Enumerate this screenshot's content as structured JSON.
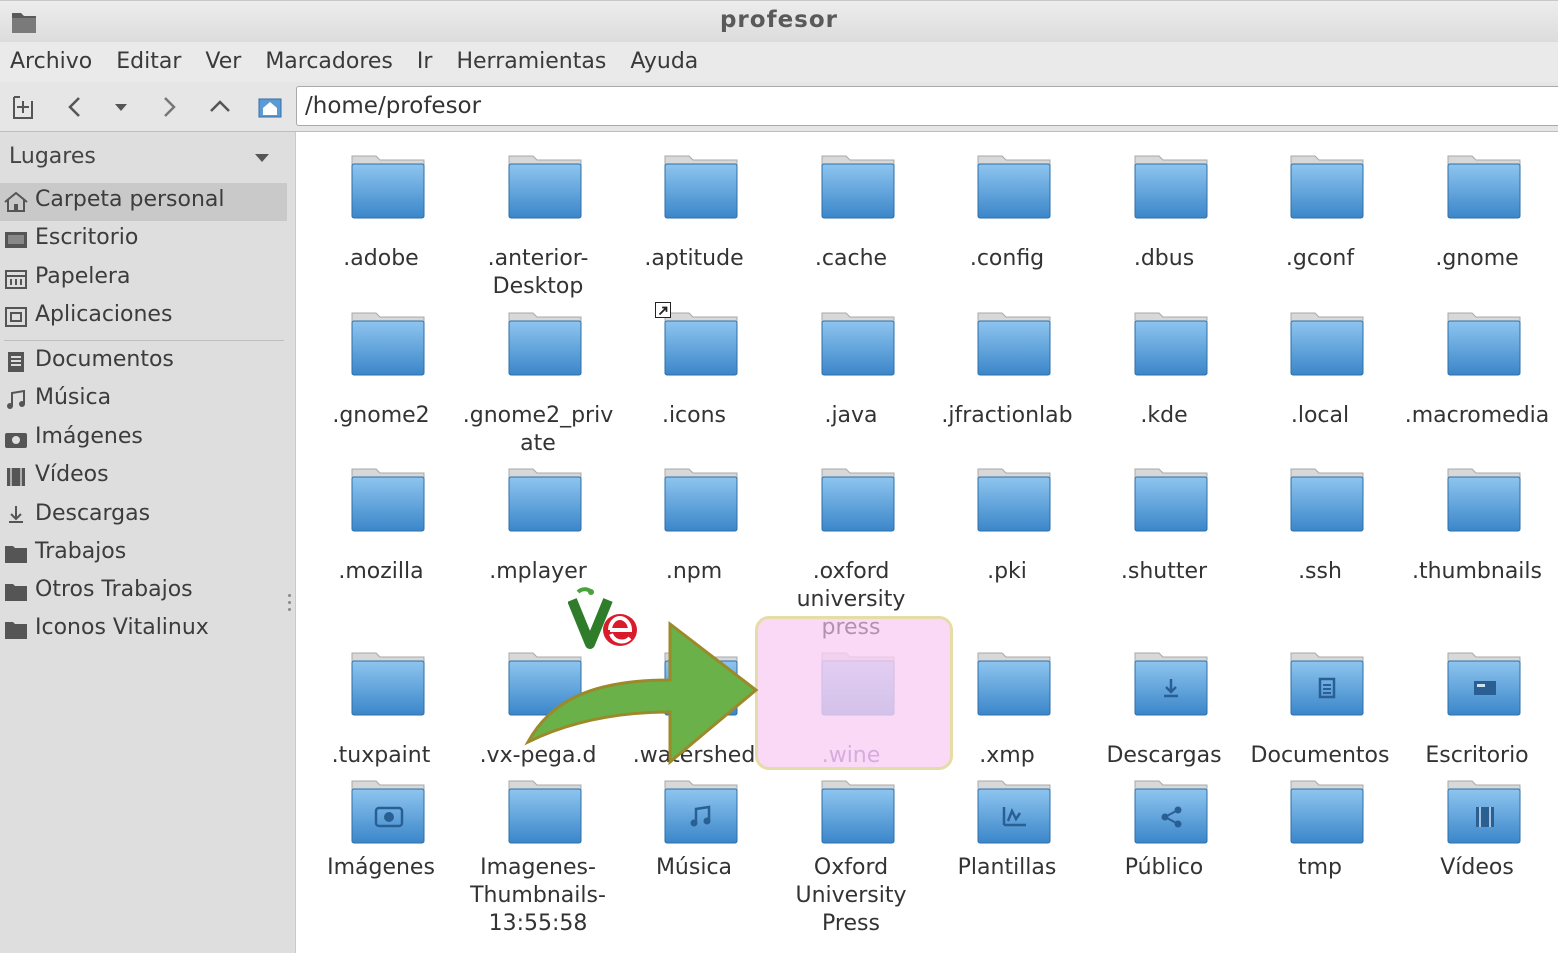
{
  "window": {
    "title": "profesor"
  },
  "menu": [
    "Archivo",
    "Editar",
    "Ver",
    "Marcadores",
    "Ir",
    "Herramientas",
    "Ayuda"
  ],
  "location": {
    "path": "/home/profesor"
  },
  "sidebar": {
    "header": "Lugares",
    "items": [
      {
        "label": "Carpeta personal",
        "icon": "home-icon",
        "active": true
      },
      {
        "label": "Escritorio",
        "icon": "desktop-icon"
      },
      {
        "label": "Papelera",
        "icon": "trash-icon"
      },
      {
        "label": "Aplicaciones",
        "icon": "applications-icon"
      },
      {
        "label": "Documentos",
        "icon": "documents-icon"
      },
      {
        "label": "Música",
        "icon": "music-icon"
      },
      {
        "label": "Imágenes",
        "icon": "camera-icon"
      },
      {
        "label": "Vídeos",
        "icon": "film-icon"
      },
      {
        "label": "Descargas",
        "icon": "download-icon"
      },
      {
        "label": "Trabajos",
        "icon": "folder-icon"
      },
      {
        "label": "Otros Trabajos",
        "icon": "folder-icon"
      },
      {
        "label": "Iconos Vitalinux",
        "icon": "folder-icon"
      }
    ]
  },
  "files": [
    {
      "name": ".adobe"
    },
    {
      "name": ".anterior-Desktop"
    },
    {
      "name": ".aptitude"
    },
    {
      "name": ".cache"
    },
    {
      "name": ".config"
    },
    {
      "name": ".dbus"
    },
    {
      "name": ".gconf"
    },
    {
      "name": ".gnome"
    },
    {
      "name": ".gnome2"
    },
    {
      "name": ".gnome2_private"
    },
    {
      "name": ".icons",
      "link": true
    },
    {
      "name": ".java"
    },
    {
      "name": ".jfractionlab"
    },
    {
      "name": ".kde"
    },
    {
      "name": ".local"
    },
    {
      "name": ".macromedia"
    },
    {
      "name": ".mozilla"
    },
    {
      "name": ".mplayer"
    },
    {
      "name": ".npm"
    },
    {
      "name": ".oxford university press"
    },
    {
      "name": ".pki"
    },
    {
      "name": ".shutter"
    },
    {
      "name": ".ssh"
    },
    {
      "name": ".thumbnails"
    },
    {
      "name": ".tuxpaint"
    },
    {
      "name": ".vx-pega.d"
    },
    {
      "name": ".watershed"
    },
    {
      "name": ".wine",
      "highlighted": true
    },
    {
      "name": ".xmp"
    },
    {
      "name": "Descargas",
      "emblem": "download-icon"
    },
    {
      "name": "Documentos",
      "emblem": "document-icon"
    },
    {
      "name": "Escritorio",
      "emblem": "desktop-icon"
    },
    {
      "name": "Imágenes",
      "emblem": "camera-icon"
    },
    {
      "name": "Imagenes-Thumbnails-13:55:58"
    },
    {
      "name": "Música",
      "emblem": "music-icon"
    },
    {
      "name": "Oxford University Press"
    },
    {
      "name": "Plantillas",
      "emblem": "template-icon"
    },
    {
      "name": "Público",
      "emblem": "share-icon"
    },
    {
      "name": "tmp"
    },
    {
      "name": "Vídeos",
      "emblem": "film-icon"
    }
  ],
  "colors": {
    "folder_top": "#8ec5ef",
    "folder_bottom": "#3b86c9",
    "highlight": "#f6c4f0",
    "arrow": "#6ab14a"
  }
}
